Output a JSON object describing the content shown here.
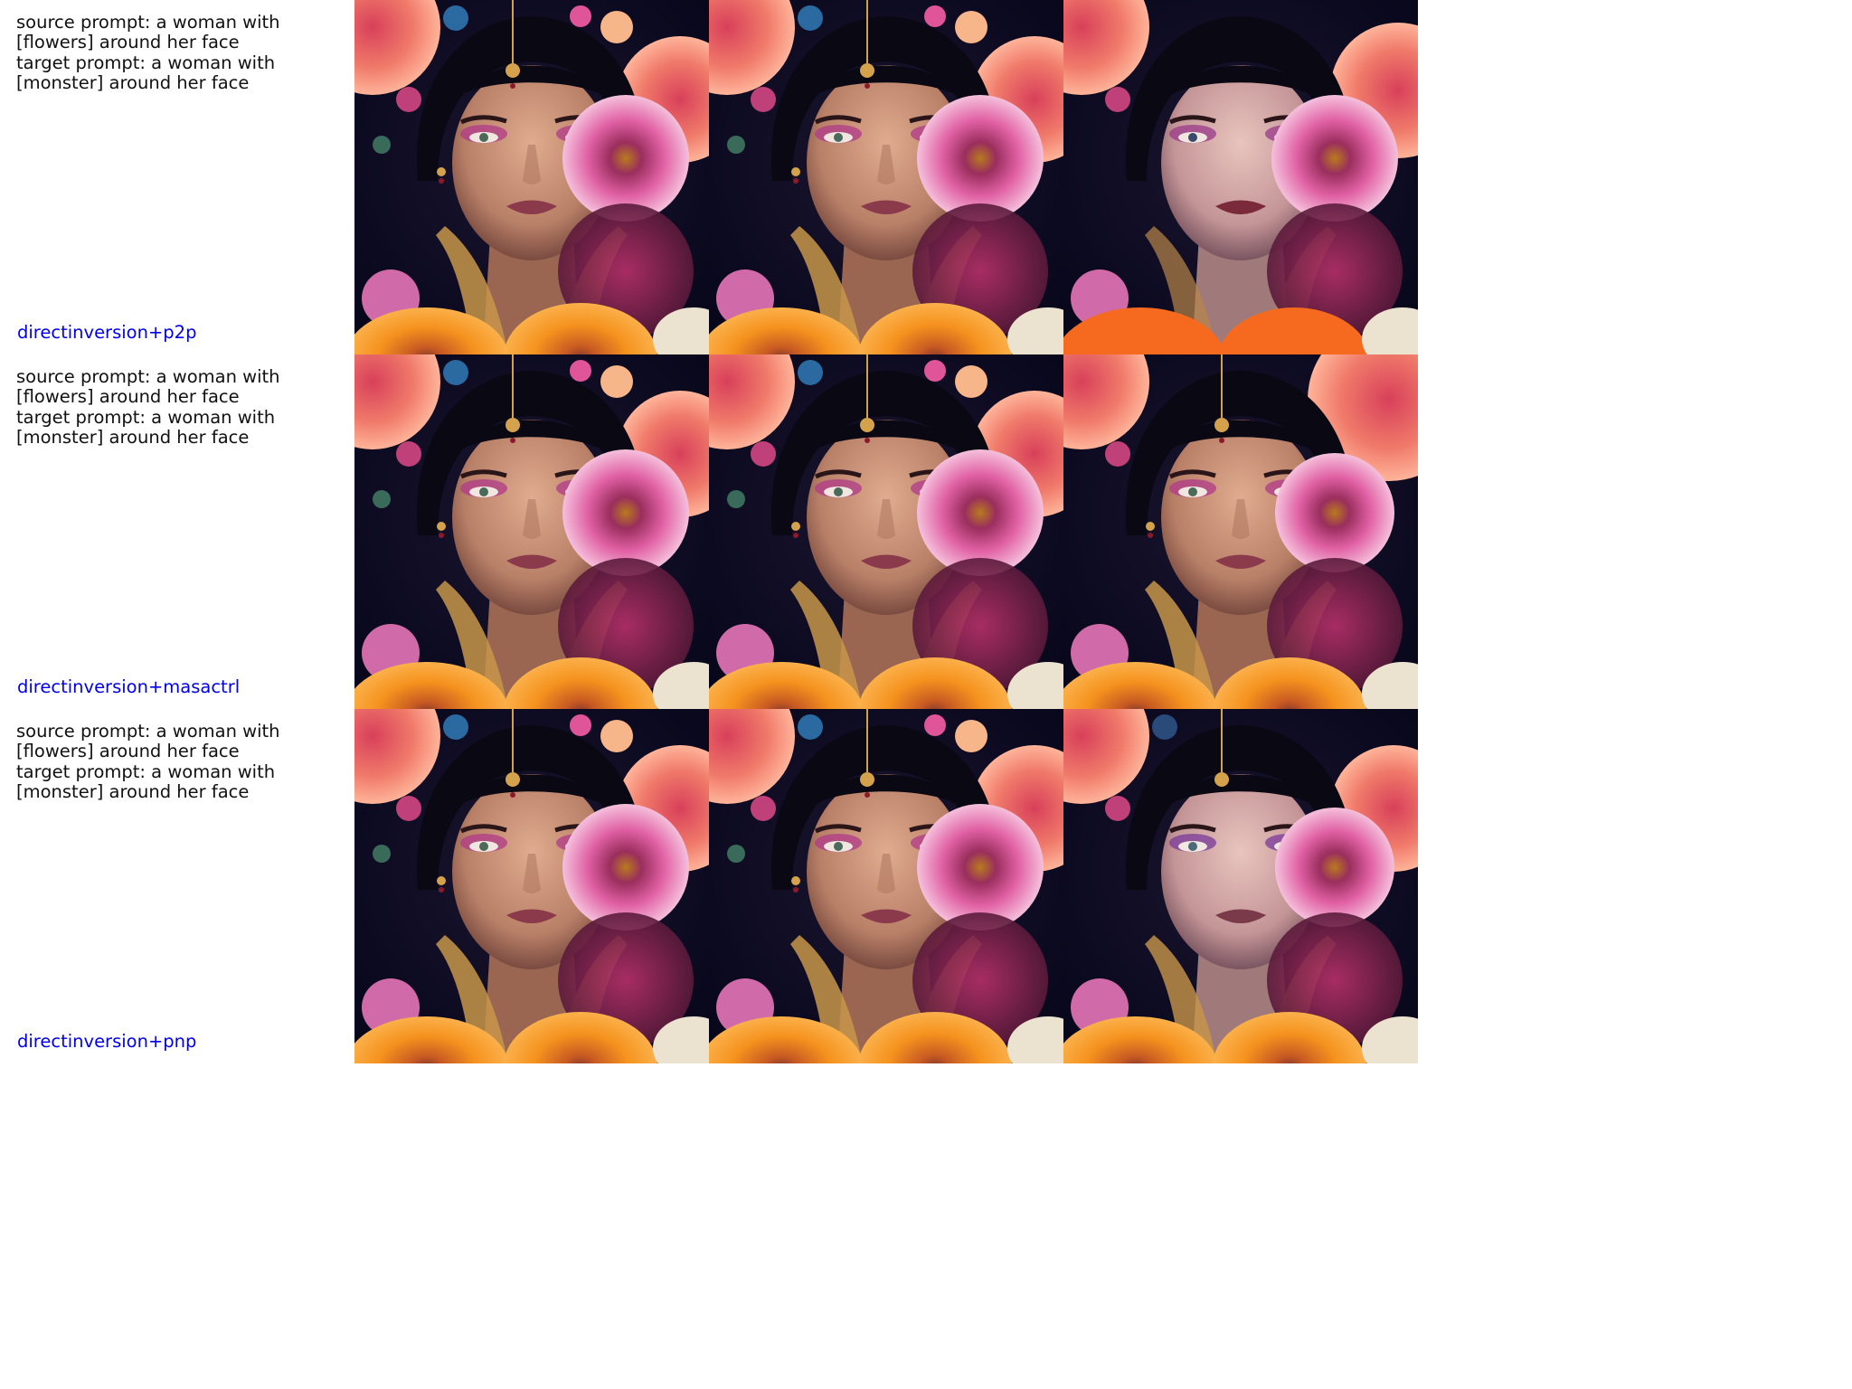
{
  "rows": [
    {
      "source_prompt": "source prompt: a woman with\n[flowers] around her face",
      "target_prompt": "target prompt: a woman with\n[monster] around her face",
      "method": "directinversion+p2p"
    },
    {
      "source_prompt": "source prompt: a woman with\n[flowers] around her face",
      "target_prompt": "target prompt: a woman with\n[monster] around her face",
      "method": "directinversion+masactrl"
    },
    {
      "source_prompt": "source prompt: a woman with\n[flowers] around her face",
      "target_prompt": "target prompt: a woman with\n[monster] around her face",
      "method": "directinversion+pnp"
    }
  ],
  "colors": {
    "method_label": "#0000ee",
    "prompt_text": "#111111",
    "background_dark": "#0d0b1e",
    "skin": "#c9957a",
    "pink_flower": "#e0559a",
    "coral_flower": "#f07a6a",
    "orange_flower": "#f5921e"
  }
}
